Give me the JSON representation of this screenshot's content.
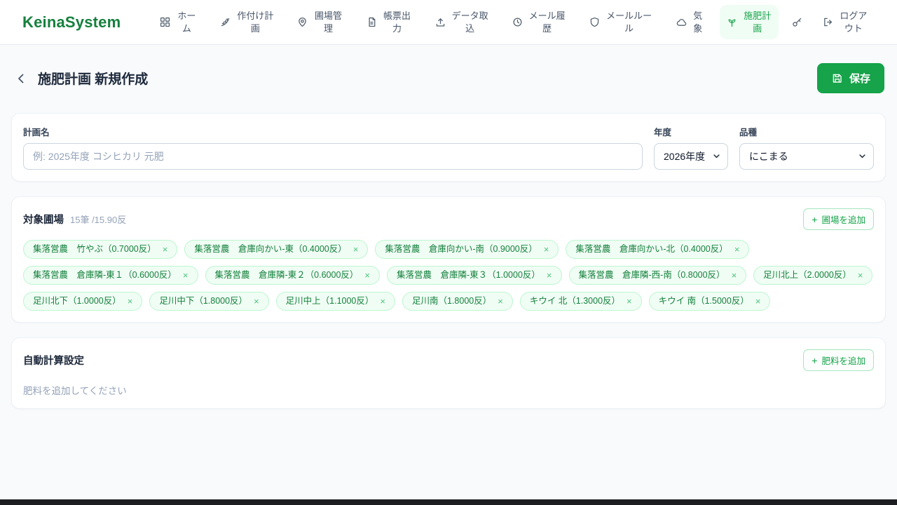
{
  "brand": {
    "name": "KeinaSystem"
  },
  "nav": {
    "items": [
      {
        "label": "ホーム",
        "icon": "grid-icon"
      },
      {
        "label": "作付け計画",
        "icon": "wheat-icon"
      },
      {
        "label": "圃場管理",
        "icon": "map-pin-icon"
      },
      {
        "label": "帳票出力",
        "icon": "document-icon"
      },
      {
        "label": "データ取込",
        "icon": "upload-icon"
      },
      {
        "label": "メール履歴",
        "icon": "history-icon"
      },
      {
        "label": "メールルール",
        "icon": "shield-icon"
      },
      {
        "label": "気象",
        "icon": "cloud-icon"
      },
      {
        "label": "施肥計画",
        "icon": "sprout-icon",
        "active": true
      },
      {
        "label": "",
        "icon": "key-icon"
      },
      {
        "label": "ログアウト",
        "icon": "logout-icon"
      }
    ]
  },
  "header": {
    "title": "施肥計画 新規作成",
    "save_label": "保存"
  },
  "plan_form": {
    "name_label": "計画名",
    "name_value": "",
    "name_placeholder": "例: 2025年度 コシヒカリ 元肥",
    "year_label": "年度",
    "year_value": "2026年度",
    "variety_label": "品種",
    "variety_value": "にこまる"
  },
  "target_fields": {
    "title": "対象圃場",
    "summary": "15筆 /15.90反",
    "add_label": "圃場を追加",
    "chips": [
      "集落営農　竹やぶ（0.7000反）",
      "集落営農　倉庫向かい-東（0.4000反）",
      "集落営農　倉庫向かい-南（0.9000反）",
      "集落営農　倉庫向かい-北（0.4000反）",
      "集落営農　倉庫隣-東１（0.6000反）",
      "集落営農　倉庫隣-東２（0.6000反）",
      "集落営農　倉庫隣-東３（1.0000反）",
      "集落営農　倉庫隣-西-南（0.8000反）",
      "足川北上（2.0000反）",
      "足川北下（1.0000反）",
      "足川中下（1.8000反）",
      "足川中上（1.1000反）",
      "足川南（1.8000反）",
      "キウイ 北（1.3000反）",
      "キウイ 南（1.5000反）"
    ]
  },
  "auto_calc": {
    "title": "自動計算設定",
    "add_label": "肥料を追加",
    "empty_text": "肥料を追加してください"
  },
  "icons": {
    "close": "×",
    "plus": "+"
  },
  "colors": {
    "accent": "#16a34a",
    "brand_green": "#15803d",
    "chip_bg": "#f0fdf4",
    "chip_border": "#bbf7d0",
    "page_bg": "#f8fafc"
  }
}
